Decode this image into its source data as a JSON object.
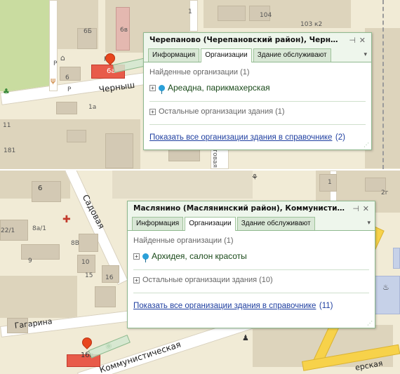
{
  "top": {
    "popup": {
      "title": "Черепаново (Черепановский район), Чернышевског...",
      "pin_icon": "pin-icon",
      "close_icon": "close-icon",
      "tabs": [
        {
          "label": "Информация",
          "active": false
        },
        {
          "label": "Организации",
          "active": true
        },
        {
          "label": "Здание обслуживают",
          "active": false
        }
      ],
      "menu_icon": "dropdown-icon",
      "found_header": "Найденные организации (1)",
      "organization": "Ареадна, парикмахерская",
      "other_label": "Остальные организации здания (1)",
      "show_all_link": "Показать все организации здания в справочнике",
      "show_all_count": "(2)"
    },
    "map": {
      "labels": [
        "6Б",
        "6в",
        "6а",
        "6",
        "104",
        "103 к2",
        "1",
        "1а",
        "11",
        "181",
        "товая",
        "Р",
        "Р",
        "Р",
        "Р"
      ],
      "street": "Черныш",
      "selected_building": "6а"
    }
  },
  "bottom": {
    "popup": {
      "title": "Маслянино (Маслянинский район), Коммунистическая...",
      "pin_icon": "pin-icon",
      "close_icon": "close-icon",
      "tabs": [
        {
          "label": "Информация",
          "active": false
        },
        {
          "label": "Организации",
          "active": true
        },
        {
          "label": "Здание обслуживают",
          "active": false
        }
      ],
      "menu_icon": "dropdown-icon",
      "found_header": "Найденные организации (1)",
      "organization": "Архидея, салон красоты",
      "other_label": "Остальные организации здания (10)",
      "show_all_link": "Показать все организации здания в справочнике",
      "show_all_count": "(11)"
    },
    "map": {
      "labels": [
        "6",
        "22/1",
        "8а/1",
        "8В",
        "9",
        "10",
        "16",
        "15",
        "1",
        "2г",
        "1бa"
      ],
      "streets": [
        "Садовая",
        "Гагарина",
        "Коммунистическая",
        "ерская"
      ],
      "selected_building": "1бa"
    }
  },
  "colors": {
    "popup_border": "#8fb98f",
    "link": "#1f3fa0",
    "selected_building": "#e85b4a",
    "marker": "#e8461e"
  }
}
